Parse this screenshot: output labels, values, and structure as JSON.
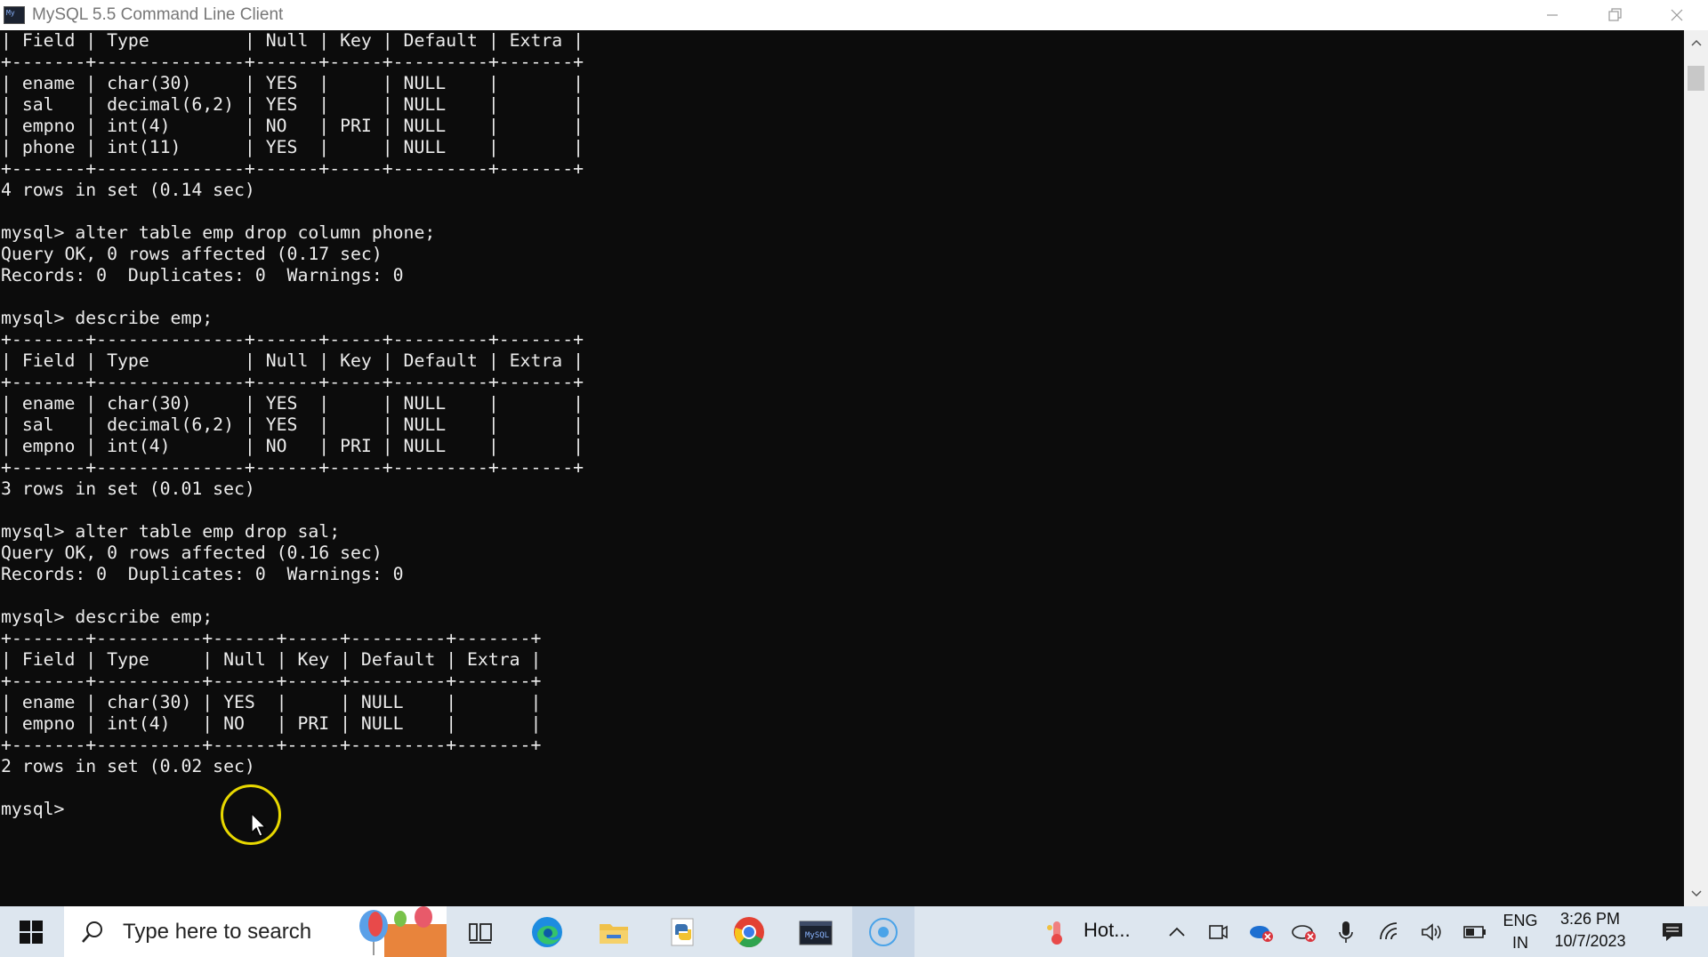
{
  "window": {
    "title": "MySQL 5.5 Command Line Client",
    "icon_label": "My"
  },
  "console": {
    "lines": [
      "| Field | Type         | Null | Key | Default | Extra |",
      "+-------+--------------+------+-----+---------+-------+",
      "| ename | char(30)     | YES  |     | NULL    |       |",
      "| sal   | decimal(6,2) | YES  |     | NULL    |       |",
      "| empno | int(4)       | NO   | PRI | NULL    |       |",
      "| phone | int(11)      | YES  |     | NULL    |       |",
      "+-------+--------------+------+-----+---------+-------+",
      "4 rows in set (0.14 sec)",
      "",
      "mysql> alter table emp drop column phone;",
      "Query OK, 0 rows affected (0.17 sec)",
      "Records: 0  Duplicates: 0  Warnings: 0",
      "",
      "mysql> describe emp;",
      "+-------+--------------+------+-----+---------+-------+",
      "| Field | Type         | Null | Key | Default | Extra |",
      "+-------+--------------+------+-----+---------+-------+",
      "| ename | char(30)     | YES  |     | NULL    |       |",
      "| sal   | decimal(6,2) | YES  |     | NULL    |       |",
      "| empno | int(4)       | NO   | PRI | NULL    |       |",
      "+-------+--------------+------+-----+---------+-------+",
      "3 rows in set (0.01 sec)",
      "",
      "mysql> alter table emp drop sal;",
      "Query OK, 0 rows affected (0.16 sec)",
      "Records: 0  Duplicates: 0  Warnings: 0",
      "",
      "mysql> describe emp;",
      "+-------+----------+------+-----+---------+-------+",
      "| Field | Type     | Null | Key | Default | Extra |",
      "+-------+----------+------+-----+---------+-------+",
      "| ename | char(30) | YES  |     | NULL    |       |",
      "| empno | int(4)   | NO   | PRI | NULL    |       |",
      "+-------+----------+------+-----+---------+-------+",
      "2 rows in set (0.02 sec)",
      "",
      "mysql>"
    ]
  },
  "taskbar": {
    "search_placeholder": "Type here to search",
    "weather_label": "Hot...",
    "language_line1": "ENG",
    "language_line2": "IN",
    "time": "3:26 PM",
    "date": "10/7/2023",
    "icons": [
      "windows-start-icon",
      "search-icon",
      "task-view-icon",
      "edge-icon",
      "file-explorer-icon",
      "python-icon",
      "chrome-icon",
      "mysql-icon",
      "screen-recorder-icon"
    ]
  },
  "colors": {
    "console_bg": "#0c0c0c",
    "console_fg": "#ececec",
    "taskbar_bg": "#dde6ef",
    "cursor_ring": "#e8d800"
  }
}
